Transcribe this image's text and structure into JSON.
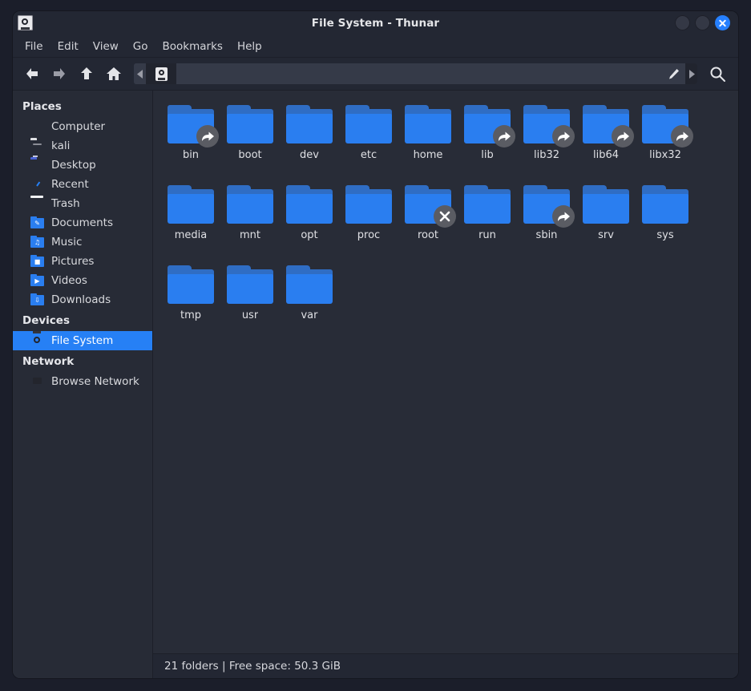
{
  "window": {
    "title": "File System - Thunar",
    "app_icon": "hard-drive-icon",
    "controls": {
      "minimize": "minimize-button",
      "maximize": "maximize-button",
      "close": "close-button"
    },
    "accent_color": "#2680f5",
    "titlebar_bg": "#232733",
    "content_bg": "#282c37",
    "folder_color": "#2a7ef0"
  },
  "menubar": {
    "items": [
      {
        "label": "File"
      },
      {
        "label": "Edit"
      },
      {
        "label": "View"
      },
      {
        "label": "Go"
      },
      {
        "label": "Bookmarks"
      },
      {
        "label": "Help"
      }
    ]
  },
  "toolbar": {
    "back": "back-arrow-icon",
    "forward": "forward-arrow-icon",
    "up": "up-arrow-icon",
    "home": "home-icon",
    "pathbar": {
      "scroll_left": "chevron-left-icon",
      "scroll_right": "chevron-right-icon",
      "crumb_icon": "hard-drive-icon",
      "crumb_label": "",
      "edit_icon": "pencil-icon",
      "entry_value": "",
      "entry_placeholder": ""
    },
    "search": "search-icon"
  },
  "sidebar": {
    "sections": [
      {
        "title": "Places",
        "items": [
          {
            "label": "Computer",
            "icon": "computer-icon",
            "selected": false
          },
          {
            "label": "kali",
            "icon": "home-folder-icon",
            "selected": false
          },
          {
            "label": "Desktop",
            "icon": "desktop-icon",
            "selected": false
          },
          {
            "label": "Recent",
            "icon": "clock-icon",
            "selected": false
          },
          {
            "label": "Trash",
            "icon": "trash-icon",
            "selected": false
          },
          {
            "label": "Documents",
            "icon": "documents-icon",
            "selected": false
          },
          {
            "label": "Music",
            "icon": "music-icon",
            "selected": false
          },
          {
            "label": "Pictures",
            "icon": "pictures-icon",
            "selected": false
          },
          {
            "label": "Videos",
            "icon": "videos-icon",
            "selected": false
          },
          {
            "label": "Downloads",
            "icon": "downloads-icon",
            "selected": false
          }
        ]
      },
      {
        "title": "Devices",
        "items": [
          {
            "label": "File System",
            "icon": "hard-drive-icon",
            "selected": true
          }
        ]
      },
      {
        "title": "Network",
        "items": [
          {
            "label": "Browse Network",
            "icon": "network-icon",
            "selected": false
          }
        ]
      }
    ]
  },
  "files": [
    {
      "name": "bin",
      "emblem": "symlink-emblem"
    },
    {
      "name": "boot",
      "emblem": null
    },
    {
      "name": "dev",
      "emblem": null
    },
    {
      "name": "etc",
      "emblem": null
    },
    {
      "name": "home",
      "emblem": null
    },
    {
      "name": "lib",
      "emblem": "symlink-emblem"
    },
    {
      "name": "lib32",
      "emblem": "symlink-emblem"
    },
    {
      "name": "lib64",
      "emblem": "symlink-emblem"
    },
    {
      "name": "libx32",
      "emblem": "symlink-emblem"
    },
    {
      "name": "media",
      "emblem": null
    },
    {
      "name": "mnt",
      "emblem": null
    },
    {
      "name": "opt",
      "emblem": null
    },
    {
      "name": "proc",
      "emblem": null
    },
    {
      "name": "root",
      "emblem": "unreadable-emblem"
    },
    {
      "name": "run",
      "emblem": null
    },
    {
      "name": "sbin",
      "emblem": "symlink-emblem"
    },
    {
      "name": "srv",
      "emblem": null
    },
    {
      "name": "sys",
      "emblem": null
    },
    {
      "name": "tmp",
      "emblem": null
    },
    {
      "name": "usr",
      "emblem": null
    },
    {
      "name": "var",
      "emblem": null
    }
  ],
  "statusbar": {
    "text": "21 folders  |  Free space: 50.3 GiB"
  }
}
